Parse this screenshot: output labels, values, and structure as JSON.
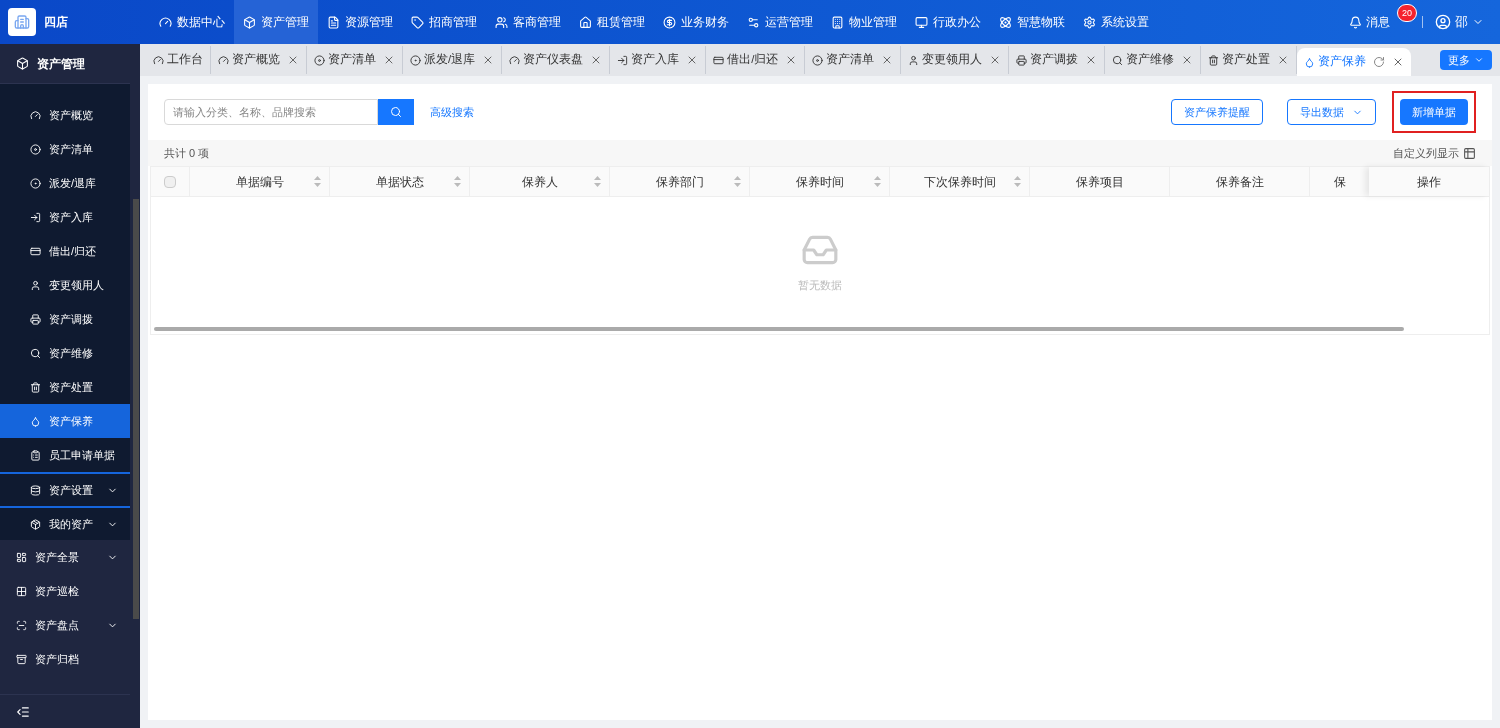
{
  "brand": {
    "name": "四店"
  },
  "top_nav": [
    {
      "label": "数据中心",
      "selected": false
    },
    {
      "label": "资产管理",
      "selected": true
    },
    {
      "label": "资源管理",
      "selected": false
    },
    {
      "label": "招商管理",
      "selected": false
    },
    {
      "label": "客商管理",
      "selected": false
    },
    {
      "label": "租赁管理",
      "selected": false
    },
    {
      "label": "业务财务",
      "selected": false
    },
    {
      "label": "运营管理",
      "selected": false
    },
    {
      "label": "物业管理",
      "selected": false
    },
    {
      "label": "行政办公",
      "selected": false
    },
    {
      "label": "智慧物联",
      "selected": false
    },
    {
      "label": "系统设置",
      "selected": false
    }
  ],
  "messages": {
    "label": "消息",
    "badge": "20"
  },
  "user": {
    "name": "邵"
  },
  "sidebar": {
    "title": "资产管理",
    "sub_items": [
      {
        "label": "资产概览",
        "selected": false
      },
      {
        "label": "资产清单",
        "selected": false
      },
      {
        "label": "派发/退库",
        "selected": false
      },
      {
        "label": "资产入库",
        "selected": false
      },
      {
        "label": "借出/归还",
        "selected": false
      },
      {
        "label": "变更领用人",
        "selected": false
      },
      {
        "label": "资产调拨",
        "selected": false
      },
      {
        "label": "资产维修",
        "selected": false
      },
      {
        "label": "资产处置",
        "selected": false
      },
      {
        "label": "资产保养",
        "selected": true
      },
      {
        "label": "员工申请单据",
        "selected": false
      }
    ],
    "sub_groups": [
      {
        "label": "资产设置",
        "expanded": false
      },
      {
        "label": "我的资产",
        "expanded": false
      }
    ],
    "items": [
      {
        "label": "资产全景",
        "expandable": true
      },
      {
        "label": "资产巡检",
        "expandable": false
      },
      {
        "label": "资产盘点",
        "expandable": true
      },
      {
        "label": "资产归档",
        "expandable": false
      }
    ]
  },
  "tabs": [
    {
      "label": "工作台",
      "selected": false,
      "closable": false
    },
    {
      "label": "资产概览",
      "selected": false,
      "closable": true
    },
    {
      "label": "资产清单",
      "selected": false,
      "closable": true
    },
    {
      "label": "派发/退库",
      "selected": false,
      "closable": true
    },
    {
      "label": "资产仪表盘",
      "selected": false,
      "closable": true
    },
    {
      "label": "资产入库",
      "selected": false,
      "closable": true
    },
    {
      "label": "借出/归还",
      "selected": false,
      "closable": true
    },
    {
      "label": "资产清单",
      "selected": false,
      "closable": true
    },
    {
      "label": "变更领用人",
      "selected": false,
      "closable": true
    },
    {
      "label": "资产调拨",
      "selected": false,
      "closable": true
    },
    {
      "label": "资产维修",
      "selected": false,
      "closable": true
    },
    {
      "label": "资产处置",
      "selected": false,
      "closable": true
    },
    {
      "label": "资产保养",
      "selected": true,
      "closable": true
    }
  ],
  "more_button": "更多",
  "search": {
    "placeholder": "请输入分类、名称、品牌搜索"
  },
  "advanced_search": "高级搜索",
  "actions": [
    {
      "label": "资产保养提醒",
      "kind": "outline",
      "highlighted": false
    },
    {
      "label": "导出数据",
      "kind": "dropdown",
      "highlighted": false
    },
    {
      "label": "新增单据",
      "kind": "primary",
      "highlighted": true
    }
  ],
  "total": "共计 0 项",
  "custom_columns": "自定义列显示",
  "table": {
    "columns": [
      {
        "label": "单据编号",
        "sortable": true
      },
      {
        "label": "单据状态",
        "sortable": true
      },
      {
        "label": "保养人",
        "sortable": true
      },
      {
        "label": "保养部门",
        "sortable": true
      },
      {
        "label": "保养时间",
        "sortable": true
      },
      {
        "label": "下次保养时间",
        "sortable": true
      },
      {
        "label": "保养项目",
        "sortable": false
      },
      {
        "label": "保养备注",
        "sortable": false
      },
      {
        "label": "保",
        "sortable": false
      }
    ],
    "fixed_column": "操作",
    "select_all_checked": false,
    "empty_text": "暂无数据"
  }
}
